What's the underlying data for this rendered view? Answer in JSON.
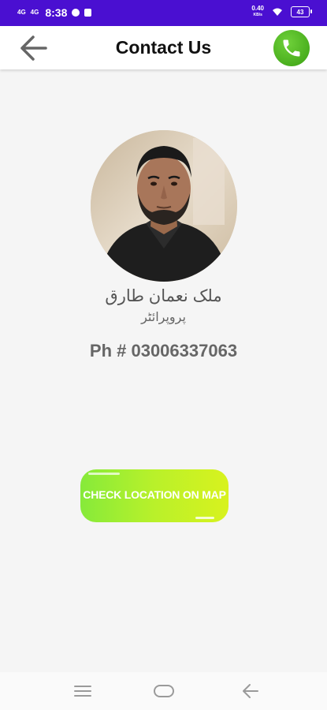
{
  "status_bar": {
    "signal_1": "4G",
    "signal_2": "4G",
    "time": "8:38",
    "net_speed": "0.40",
    "net_unit": "KB/s",
    "battery": "43"
  },
  "app_bar": {
    "title": "Contact Us"
  },
  "profile": {
    "name": "ملک نعمان طارق",
    "role": "پروپرائٹر",
    "phone": "Ph # 03006337063"
  },
  "map_button": {
    "label": "CHECK LOCATION ON MAP"
  },
  "colors": {
    "status_bar": "#4a0fd1",
    "call_button": "#4cb51f",
    "map_button_start": "#86ea3a",
    "map_button_end": "#d8f21e"
  },
  "icons": {
    "back": "arrow-left-icon",
    "call": "phone-icon",
    "nav_menu": "menu-icon",
    "nav_home": "home-icon",
    "nav_back": "back-icon"
  }
}
